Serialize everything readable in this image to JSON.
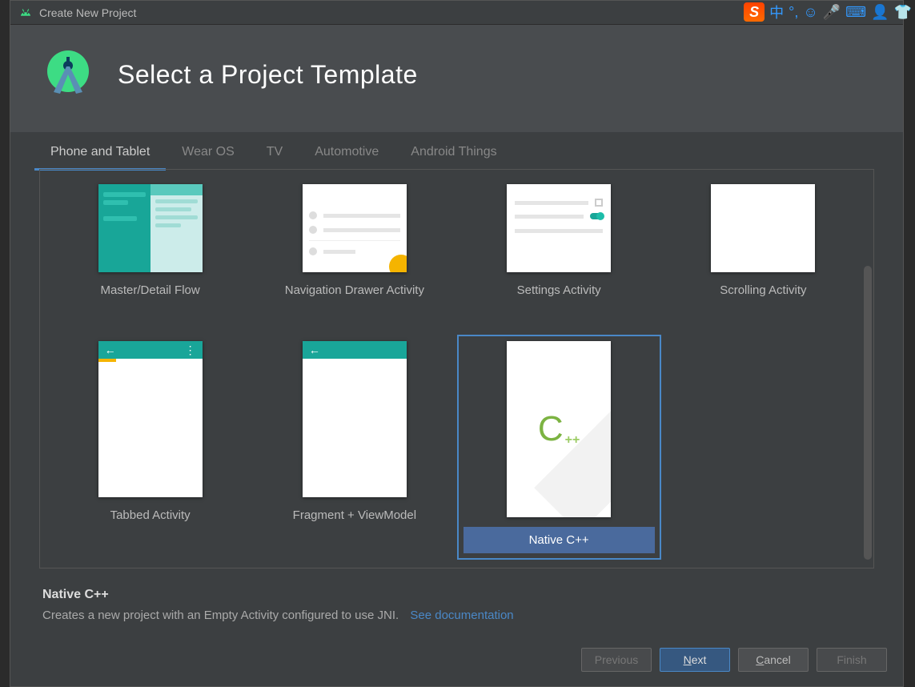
{
  "titlebar": {
    "title": "Create New Project"
  },
  "ime": {
    "lang": "中"
  },
  "header": {
    "title": "Select a Project Template"
  },
  "tabs": [
    {
      "label": "Phone and Tablet",
      "active": true
    },
    {
      "label": "Wear OS",
      "active": false
    },
    {
      "label": "TV",
      "active": false
    },
    {
      "label": "Automotive",
      "active": false
    },
    {
      "label": "Android Things",
      "active": false
    }
  ],
  "templates": {
    "row1": [
      {
        "id": "master-detail",
        "label": "Master/Detail Flow"
      },
      {
        "id": "nav-drawer",
        "label": "Navigation Drawer Activity"
      },
      {
        "id": "settings",
        "label": "Settings Activity"
      },
      {
        "id": "scrolling",
        "label": "Scrolling Activity"
      }
    ],
    "row2": [
      {
        "id": "tabbed",
        "label": "Tabbed Activity"
      },
      {
        "id": "fragment-vm",
        "label": "Fragment + ViewModel"
      },
      {
        "id": "native-cpp",
        "label": "Native C++",
        "selected": true
      },
      {
        "id": "empty",
        "label": ""
      }
    ]
  },
  "selection": {
    "title": "Native C++",
    "description": "Creates a new project with an Empty Activity configured to use JNI.",
    "doc_link": "See documentation"
  },
  "buttons": {
    "previous": "Previous",
    "next_prefix": "N",
    "next_rest": "ext",
    "cancel_prefix": "C",
    "cancel_rest": "ancel",
    "finish": "Finish"
  }
}
